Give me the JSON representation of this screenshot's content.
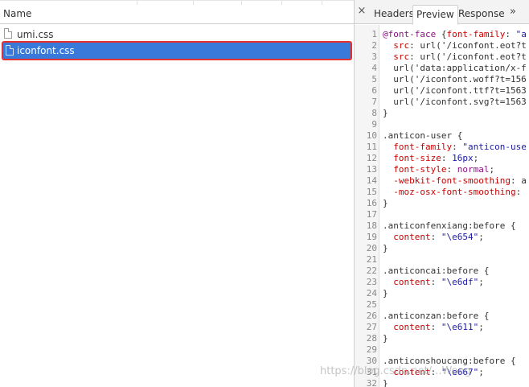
{
  "list": {
    "column_title": "Name",
    "rows": [
      {
        "name": "umi.css",
        "selected": false
      },
      {
        "name": "iconfont.css",
        "selected": true
      }
    ]
  },
  "tabs": {
    "close": "×",
    "items": [
      "Headers",
      "Preview",
      "Response"
    ],
    "active": "Preview",
    "overflow": "»"
  },
  "code": [
    {
      "n": "1",
      "t": [
        [
          "@font-face",
          "sel"
        ],
        [
          " {",
          "punc"
        ],
        [
          "font-family",
          "prop"
        ],
        [
          ": ",
          "punc"
        ],
        [
          "\"a",
          "str"
        ]
      ]
    },
    {
      "n": "2",
      "t": [
        [
          "  src",
          "prop"
        ],
        [
          ": ",
          "punc"
        ],
        [
          "url('/iconfont.eot?t",
          "plain"
        ]
      ]
    },
    {
      "n": "3",
      "t": [
        [
          "  src",
          "prop"
        ],
        [
          ": ",
          "punc"
        ],
        [
          "url('/iconfont.eot?t",
          "plain"
        ]
      ]
    },
    {
      "n": "4",
      "t": [
        [
          "  url('data:application/x-f",
          "plain"
        ]
      ]
    },
    {
      "n": "5",
      "t": [
        [
          "  url('/iconfont.woff?t=156",
          "plain"
        ]
      ]
    },
    {
      "n": "6",
      "t": [
        [
          "  url('/iconfont.ttf?t=1563",
          "plain"
        ]
      ]
    },
    {
      "n": "7",
      "t": [
        [
          "  url('/iconfont.svg?t=1563",
          "plain"
        ]
      ]
    },
    {
      "n": "8",
      "t": [
        [
          "}",
          "punc"
        ]
      ]
    },
    {
      "n": "9",
      "t": []
    },
    {
      "n": "10",
      "t": [
        [
          ".anticon-user",
          "plain"
        ],
        [
          " {",
          "punc"
        ]
      ]
    },
    {
      "n": "11",
      "t": [
        [
          "  font-family",
          "prop"
        ],
        [
          ": ",
          "punc"
        ],
        [
          "\"anticon-use",
          "str"
        ]
      ]
    },
    {
      "n": "12",
      "t": [
        [
          "  font-size",
          "prop"
        ],
        [
          ": ",
          "punc"
        ],
        [
          "16px",
          "num"
        ],
        [
          ";",
          "punc"
        ]
      ]
    },
    {
      "n": "13",
      "t": [
        [
          "  font-style",
          "prop"
        ],
        [
          ": ",
          "punc"
        ],
        [
          "normal",
          "kw"
        ],
        [
          ";",
          "punc"
        ]
      ]
    },
    {
      "n": "14",
      "t": [
        [
          "  -webkit-font-smoothing",
          "prop"
        ],
        [
          ": a",
          "punc"
        ]
      ]
    },
    {
      "n": "15",
      "t": [
        [
          "  -moz-osx-font-smoothing",
          "prop"
        ],
        [
          ": ",
          "punc"
        ]
      ]
    },
    {
      "n": "16",
      "t": [
        [
          "}",
          "punc"
        ]
      ]
    },
    {
      "n": "17",
      "t": []
    },
    {
      "n": "18",
      "t": [
        [
          ".anticonfenxiang:before",
          "plain"
        ],
        [
          " {",
          "punc"
        ]
      ]
    },
    {
      "n": "19",
      "t": [
        [
          "  content",
          "prop"
        ],
        [
          ": ",
          "punc"
        ],
        [
          "\"\\e654\"",
          "str"
        ],
        [
          ";",
          "punc"
        ]
      ]
    },
    {
      "n": "20",
      "t": [
        [
          "}",
          "punc"
        ]
      ]
    },
    {
      "n": "21",
      "t": []
    },
    {
      "n": "22",
      "t": [
        [
          ".anticoncai:before",
          "plain"
        ],
        [
          " {",
          "punc"
        ]
      ]
    },
    {
      "n": "23",
      "t": [
        [
          "  content",
          "prop"
        ],
        [
          ": ",
          "punc"
        ],
        [
          "\"\\e6df\"",
          "str"
        ],
        [
          ";",
          "punc"
        ]
      ]
    },
    {
      "n": "24",
      "t": [
        [
          "}",
          "punc"
        ]
      ]
    },
    {
      "n": "25",
      "t": []
    },
    {
      "n": "26",
      "t": [
        [
          ".anticonzan:before",
          "plain"
        ],
        [
          " {",
          "punc"
        ]
      ]
    },
    {
      "n": "27",
      "t": [
        [
          "  content",
          "prop"
        ],
        [
          ": ",
          "punc"
        ],
        [
          "\"\\e611\"",
          "str"
        ],
        [
          ";",
          "punc"
        ]
      ]
    },
    {
      "n": "28",
      "t": [
        [
          "}",
          "punc"
        ]
      ]
    },
    {
      "n": "29",
      "t": []
    },
    {
      "n": "30",
      "t": [
        [
          ".anticonshoucang:before",
          "plain"
        ],
        [
          " {",
          "punc"
        ]
      ]
    },
    {
      "n": "31",
      "t": [
        [
          "  content",
          "prop"
        ],
        [
          ": ",
          "punc"
        ],
        [
          "\"\\e667\"",
          "str"
        ],
        [
          ";",
          "punc"
        ]
      ]
    },
    {
      "n": "32",
      "t": [
        [
          "}",
          "punc"
        ]
      ]
    }
  ],
  "watermark": "https://blog.csdn.net/...Wong",
  "colors": {
    "selection": "#3879d9",
    "highlight_border": "#e5312e",
    "property": "#c80000",
    "string": "#1a1aa6",
    "selector": "#881280"
  }
}
